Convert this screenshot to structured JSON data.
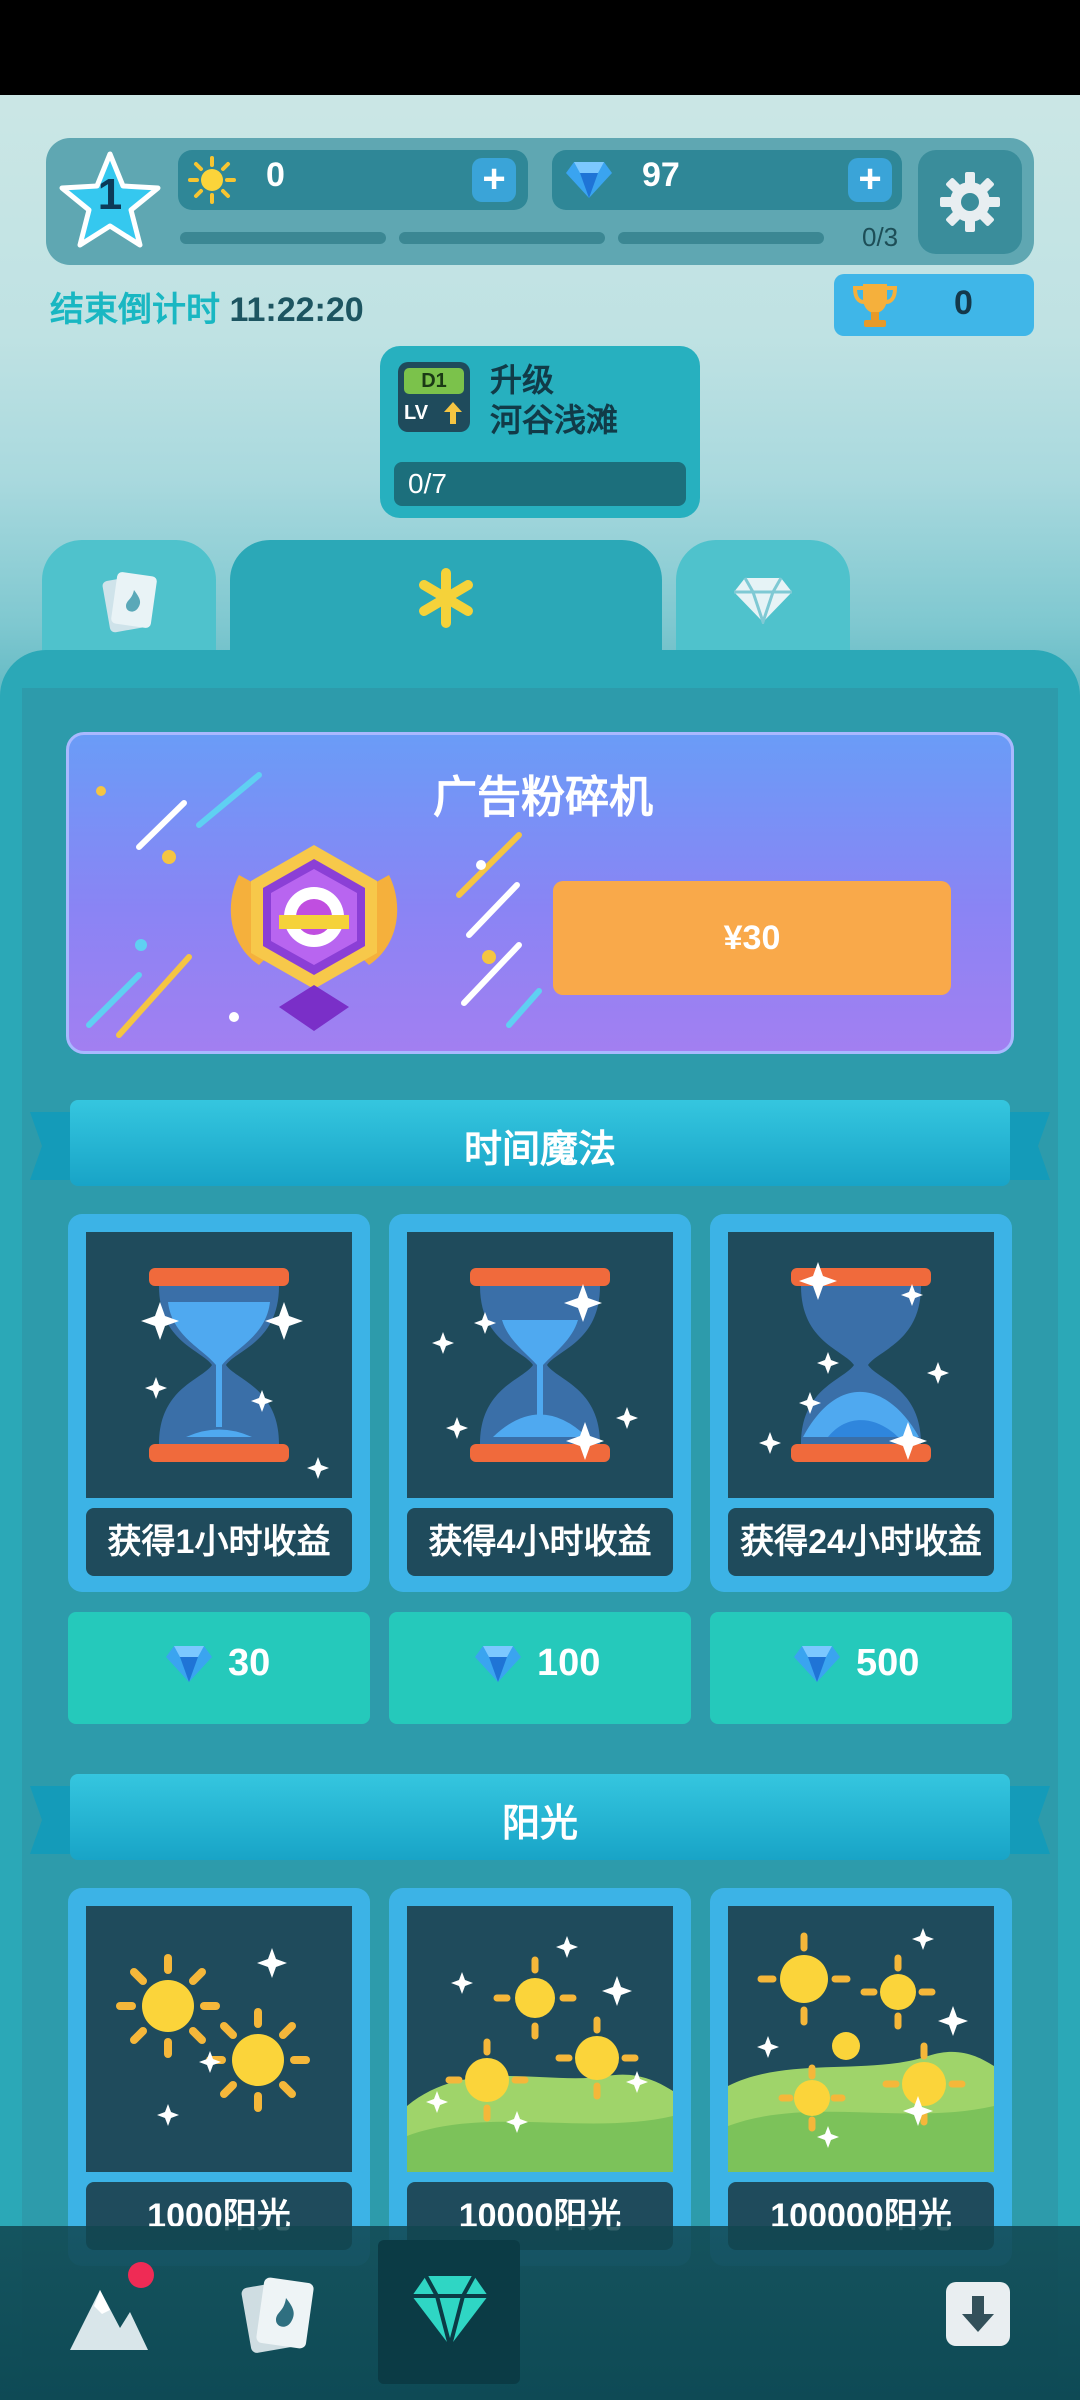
{
  "hud": {
    "level": "1",
    "sun_value": "0",
    "gem_value": "97",
    "progress_text": "0/3"
  },
  "countdown": {
    "label": "结束倒计时",
    "time": "11:22:20"
  },
  "trophy": {
    "value": "0"
  },
  "upgrade": {
    "badge_top": "D1",
    "badge_bottom": "LV",
    "title_line1": "升级",
    "title_line2": "河谷浅滩",
    "progress": "0/7"
  },
  "tabs": [
    {
      "icon": "card-icon",
      "active": false
    },
    {
      "icon": "asterisk-icon",
      "active": true
    },
    {
      "icon": "diamond-icon",
      "active": false
    }
  ],
  "ad_card": {
    "title": "广告粉碎机",
    "price": "¥30"
  },
  "time_magic": {
    "title": "时间魔法",
    "items": [
      {
        "label": "获得1小时收益",
        "price": "30"
      },
      {
        "label": "获得4小时收益",
        "price": "100"
      },
      {
        "label": "获得24小时收益",
        "price": "500"
      }
    ]
  },
  "sunshine": {
    "title": "阳光",
    "items": [
      {
        "label": "1000阳光"
      },
      {
        "label": "10000阳光"
      },
      {
        "label": "100000阳光"
      }
    ]
  },
  "colors": {
    "accent": "#2ba8b7",
    "gem": "#3aa4f0",
    "price_button": "#f9a94a",
    "notification": "#ef2b55"
  }
}
